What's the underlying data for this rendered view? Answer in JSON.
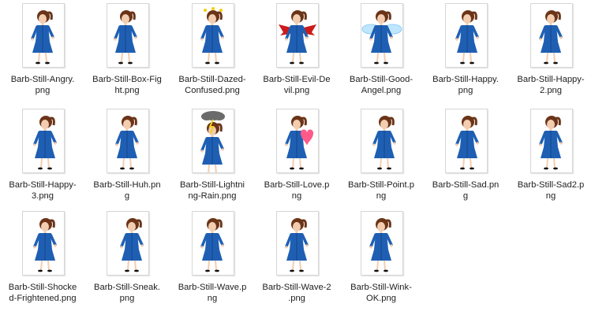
{
  "files": [
    {
      "name": "Barb-Still-Angry.png",
      "line1": "Barb-Still-Angry.",
      "line2": "png",
      "icon": "barb-angry-icon",
      "prop": "none"
    },
    {
      "name": "Barb-Still-Box-Fight.png",
      "line1": "Barb-Still-Box-Fig",
      "line2": "ht.png",
      "icon": "barb-box-fight-icon",
      "prop": "none"
    },
    {
      "name": "Barb-Still-Dazed-Confused.png",
      "line1": "Barb-Still-Dazed-",
      "line2": "Confused.png",
      "icon": "barb-dazed-confused-icon",
      "prop": "stars"
    },
    {
      "name": "Barb-Still-Evil-Devil.png",
      "line1": "Barb-Still-Evil-De",
      "line2": "vil.png",
      "icon": "barb-evil-devil-icon",
      "prop": "wings-red"
    },
    {
      "name": "Barb-Still-Good-Angel.png",
      "line1": "Barb-Still-Good-",
      "line2": "Angel.png",
      "icon": "barb-good-angel-icon",
      "prop": "wings-blue"
    },
    {
      "name": "Barb-Still-Happy.png",
      "line1": "Barb-Still-Happy.",
      "line2": "png",
      "icon": "barb-happy-icon",
      "prop": "none"
    },
    {
      "name": "Barb-Still-Happy-2.png",
      "line1": "Barb-Still-Happy-",
      "line2": "2.png",
      "icon": "barb-happy-2-icon",
      "prop": "none"
    },
    {
      "name": "Barb-Still-Happy-3.png",
      "line1": "Barb-Still-Happy-",
      "line2": "3.png",
      "icon": "barb-happy-3-icon",
      "prop": "none"
    },
    {
      "name": "Barb-Still-Huh.png",
      "line1": "Barb-Still-Huh.pn",
      "line2": "g",
      "icon": "barb-huh-icon",
      "prop": "none"
    },
    {
      "name": "Barb-Still-Lightning-Rain.png",
      "line1": "Barb-Still-Lightni",
      "line2": "ng-Rain.png",
      "icon": "barb-lightning-rain-icon",
      "prop": "cloud"
    },
    {
      "name": "Barb-Still-Love.png",
      "line1": "Barb-Still-Love.p",
      "line2": "ng",
      "icon": "barb-love-icon",
      "prop": "heart"
    },
    {
      "name": "Barb-Still-Point.png",
      "line1": "Barb-Still-Point.p",
      "line2": "ng",
      "icon": "barb-point-icon",
      "prop": "none"
    },
    {
      "name": "Barb-Still-Sad.png",
      "line1": "Barb-Still-Sad.pn",
      "line2": "g",
      "icon": "barb-sad-icon",
      "prop": "none"
    },
    {
      "name": "Barb-Still-Sad2.png",
      "line1": "Barb-Still-Sad2.p",
      "line2": "ng",
      "icon": "barb-sad2-icon",
      "prop": "none"
    },
    {
      "name": "Barb-Still-Shocked-Frightened.png",
      "line1": "Barb-Still-Shocke",
      "line2": "d-Frightened.png",
      "icon": "barb-shocked-frightened-icon",
      "prop": "none"
    },
    {
      "name": "Barb-Still-Sneak.png",
      "line1": "Barb-Still-Sneak.",
      "line2": "png",
      "icon": "barb-sneak-icon",
      "prop": "none"
    },
    {
      "name": "Barb-Still-Wave.png",
      "line1": "Barb-Still-Wave.p",
      "line2": "ng",
      "icon": "barb-wave-icon",
      "prop": "none"
    },
    {
      "name": "Barb-Still-Wave-2.png",
      "line1": "Barb-Still-Wave-2",
      "line2": ".png",
      "icon": "barb-wave-2-icon",
      "prop": "none"
    },
    {
      "name": "Barb-Still-Wink-OK.png",
      "line1": "Barb-Still-Wink-",
      "line2": "OK.png",
      "icon": "barb-wink-ok-icon",
      "prop": "none"
    }
  ],
  "colors": {
    "dress": "#1f5fb3",
    "dress_dark": "#123f7e",
    "hair": "#6b3418",
    "skin": "#f3cdb0",
    "devil_wings": "#cc1b1b",
    "angel_wings": "#bfe6ff",
    "heart": "#ff5a8a",
    "cloud": "#6b6b6b",
    "bolt": "#f2d11b",
    "stars": "#f0d000"
  }
}
